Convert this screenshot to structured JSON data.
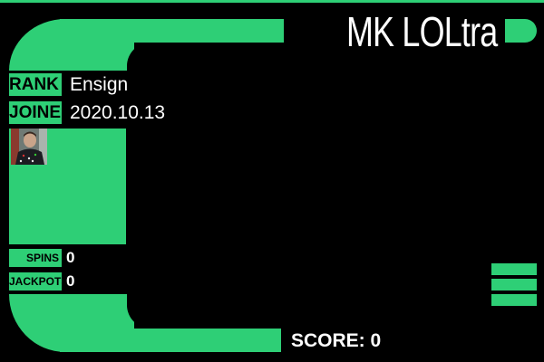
{
  "header": {
    "title": "MK LOLtra"
  },
  "profile": {
    "rank_label": "RANK",
    "rank_value": "Ensign",
    "joined_label": "JOINED",
    "joined_value": "2020.10.13",
    "spins_label": "SPINS",
    "spins_value": "0",
    "jackpots_label": "JACKPOTS",
    "jackpots_value": "0"
  },
  "footer": {
    "score_text": "SCORE: 0"
  },
  "colors": {
    "accent": "#2ecf76",
    "background": "#000000",
    "text": "#ffffff"
  },
  "icons": {
    "menu": "hamburger-menu-icon"
  }
}
